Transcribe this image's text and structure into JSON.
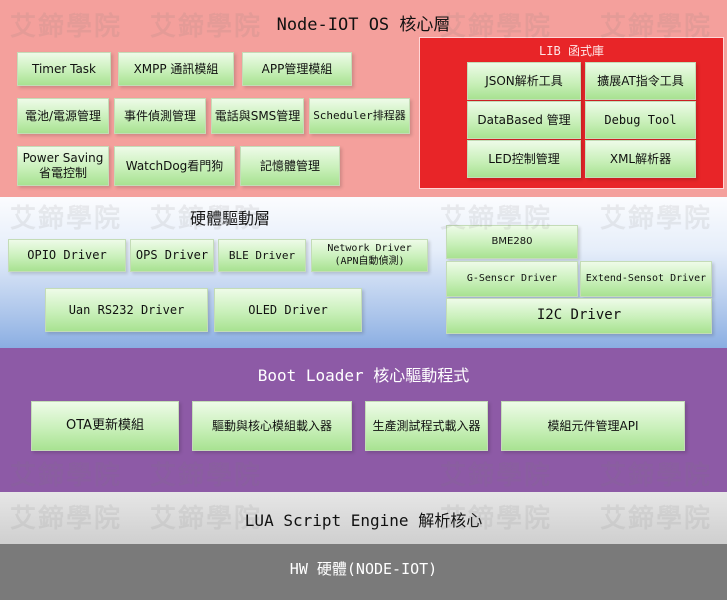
{
  "watermark": "艾鍗學院",
  "core": {
    "title": "Node-IOT OS 核心層",
    "modules": [
      "Timer Task",
      "XMPP 通訊模組",
      "APP管理模組",
      "電池/電源管理",
      "事件偵測管理",
      "電話與SMS管理",
      "Scheduler排程器",
      "Power Saving 省電控制",
      "WatchDog看門狗",
      "記憶體管理"
    ],
    "lib": {
      "title": "LIB 函式庫",
      "items": [
        "JSON解析工具",
        "擴展AT指令工具",
        "DataBased 管理",
        "Debug Tool",
        "LED控制管理",
        "XML解析器"
      ]
    }
  },
  "driver": {
    "title": "硬體驅動層",
    "items": [
      "OPIO Driver",
      "OPS Driver",
      "BLE Driver",
      "Network Driver (APN自動偵測)",
      "Uan RS232 Driver",
      "OLED Driver"
    ],
    "i2c": {
      "bme": "BME280",
      "gsensor": "G-Senscr Driver",
      "extend": "Extend-Sensot Driver",
      "main": "I2C Driver"
    }
  },
  "boot": {
    "title": "Boot Loader 核心驅動程式",
    "items": [
      "OTA更新模組",
      "驅動與核心模組載入器",
      "生產測試程式載入器",
      "模組元件管理API"
    ]
  },
  "lua": {
    "title": "LUA Script Engine 解析核心"
  },
  "hw": {
    "title": "HW 硬體(NODE-IOT)"
  },
  "colors": {
    "core_bg": "#f4a09c",
    "lib_bg": "#e82528",
    "driver_top": "#fafbfd",
    "driver_bottom": "#8aaee2",
    "boot_bg": "#8d5aa6",
    "lua_bg": "#d6d6d6",
    "hw_bg": "#7a7a7a"
  }
}
